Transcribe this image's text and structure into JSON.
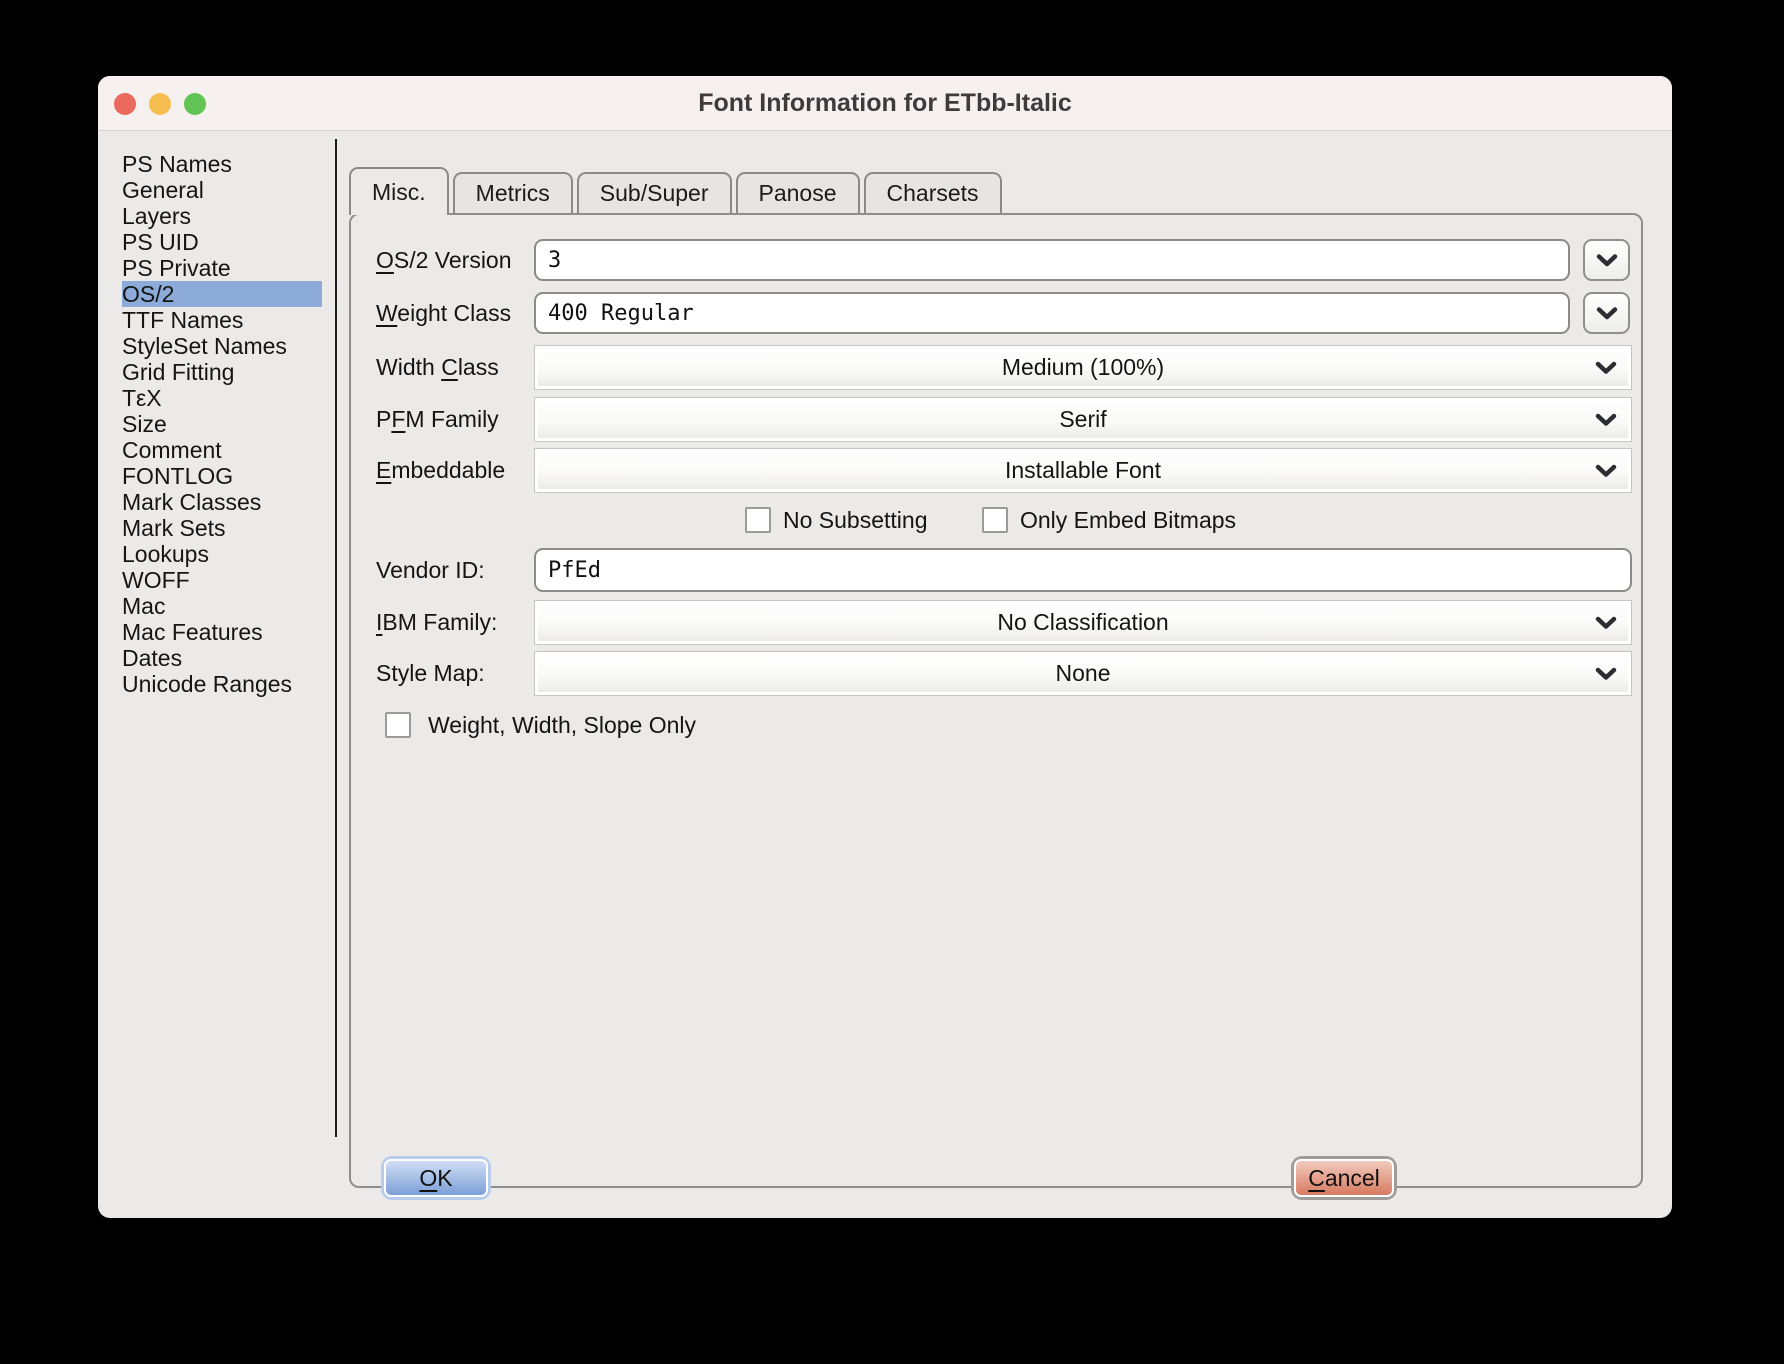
{
  "window": {
    "title": "Font Information for ETbb-Italic"
  },
  "sidebar": {
    "items": [
      {
        "label": "PS Names"
      },
      {
        "label": "General"
      },
      {
        "label": "Layers"
      },
      {
        "label": "PS UID"
      },
      {
        "label": "PS Private"
      },
      {
        "label": "OS/2",
        "selected": true
      },
      {
        "label": "TTF Names"
      },
      {
        "label": "StyleSet Names"
      },
      {
        "label": "Grid Fitting"
      },
      {
        "label": "TεX"
      },
      {
        "label": "Size"
      },
      {
        "label": "Comment"
      },
      {
        "label": "FONTLOG"
      },
      {
        "label": "Mark Classes"
      },
      {
        "label": "Mark Sets"
      },
      {
        "label": "Lookups"
      },
      {
        "label": "WOFF"
      },
      {
        "label": "Mac"
      },
      {
        "label": "Mac Features"
      },
      {
        "label": "Dates"
      },
      {
        "label": "Unicode Ranges"
      }
    ]
  },
  "tabs": [
    {
      "label": "Misc.",
      "active": true
    },
    {
      "label": "Metrics"
    },
    {
      "label": "Sub/Super"
    },
    {
      "label": "Panose"
    },
    {
      "label": "Charsets"
    }
  ],
  "form": {
    "os2_version": {
      "pre": "",
      "mn": "O",
      "post": "S/2 Version",
      "value": "3"
    },
    "weight_class": {
      "pre": "",
      "mn": "W",
      "post": "eight Class",
      "value": "400 Regular"
    },
    "width_class": {
      "pre": "Width ",
      "mn": "C",
      "post": "lass",
      "value": "Medium (100%)"
    },
    "pfm_family": {
      "pre": "P",
      "mn": "F",
      "post": "M Family",
      "value": "Serif"
    },
    "embeddable": {
      "pre": "",
      "mn": "E",
      "post": "mbeddable",
      "value": "Installable Font"
    },
    "no_subsetting": {
      "label": "No Subsetting",
      "checked": false
    },
    "only_embed_bitmaps": {
      "label": "Only Embed Bitmaps",
      "checked": false
    },
    "vendor_id": {
      "pre": "Vendor ID:",
      "mn": "",
      "post": "",
      "value": "PfEd"
    },
    "ibm_family": {
      "pre": "",
      "mn": "I",
      "post": "BM Family:",
      "value": "No Classification"
    },
    "style_map": {
      "pre": "Style Map:",
      "mn": "",
      "post": "",
      "value": "None"
    },
    "wws_only": {
      "label": "Weight, Width, Slope Only",
      "checked": false
    }
  },
  "buttons": {
    "ok": {
      "pre": "",
      "mn": "O",
      "post": "K"
    },
    "cancel": {
      "pre": "",
      "mn": "C",
      "post": "ancel"
    }
  },
  "colors": {
    "selection_blue": "#8cabd8",
    "titlebar_bg": "#f6f0ef",
    "content_bg": "#ebeae8",
    "ok_top": "#cfdef4",
    "ok_bottom": "#7c9fd7",
    "ok_ring": "#b7cbeb",
    "cancel_top": "#f2cabc",
    "cancel_bottom": "#d77a60",
    "cancel_ring": "#9d9d9b",
    "light_red": "#ec695d",
    "light_yellow": "#f4bd4e",
    "light_green": "#61c454"
  }
}
